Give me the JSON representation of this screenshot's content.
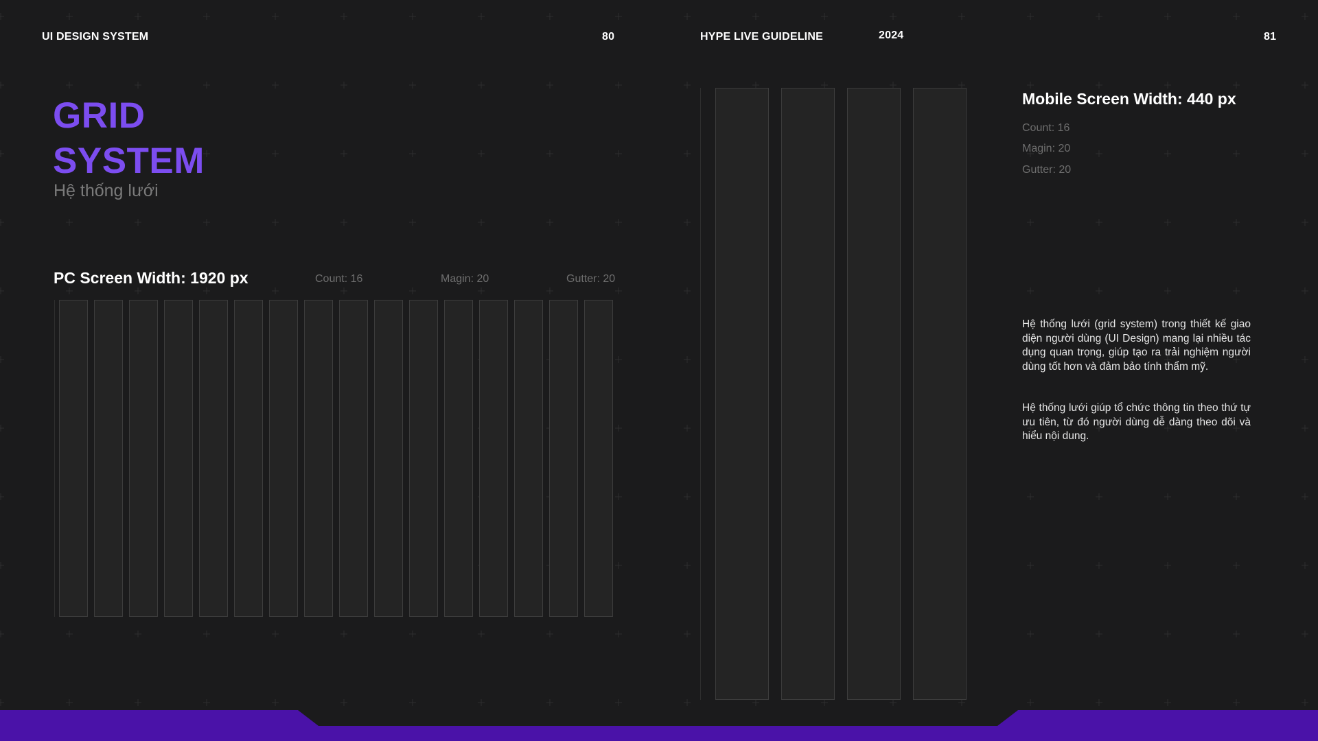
{
  "header": {
    "left_label": "UI DESIGN SYSTEM",
    "left_page": "80",
    "right_label": "HYPE LIVE GUIDELINE",
    "year": "2024",
    "right_page": "81"
  },
  "title": {
    "line1": "GRID",
    "line2": "SYSTEM",
    "subtitle": "Hệ thống lưới"
  },
  "pc": {
    "heading": "PC Screen Width: 1920 px",
    "count": "Count: 16",
    "margin": "Magin: 20",
    "gutter": "Gutter: 20",
    "columns": 16
  },
  "mobile": {
    "heading": "Mobile Screen Width: 440 px",
    "count": "Count: 16",
    "margin": "Magin: 20",
    "gutter": "Gutter: 20",
    "columns": 4
  },
  "description": {
    "p1": "Hệ thống lưới (grid system) trong thiết kế giao diện người dùng (UI Design) mang lại nhiều tác dụng quan trọng, giúp tạo ra trải nghiệm người dùng tốt hơn và đảm bảo tính thẩm mỹ.",
    "p2": "Hệ thống lưới giúp tổ chức thông tin theo thứ tự ưu tiên, từ đó người dùng dễ dàng theo dõi và hiểu nội dung."
  },
  "colors": {
    "background": "#1b1b1c",
    "accent": "#7c4df0",
    "footer": "#4a12a8"
  }
}
